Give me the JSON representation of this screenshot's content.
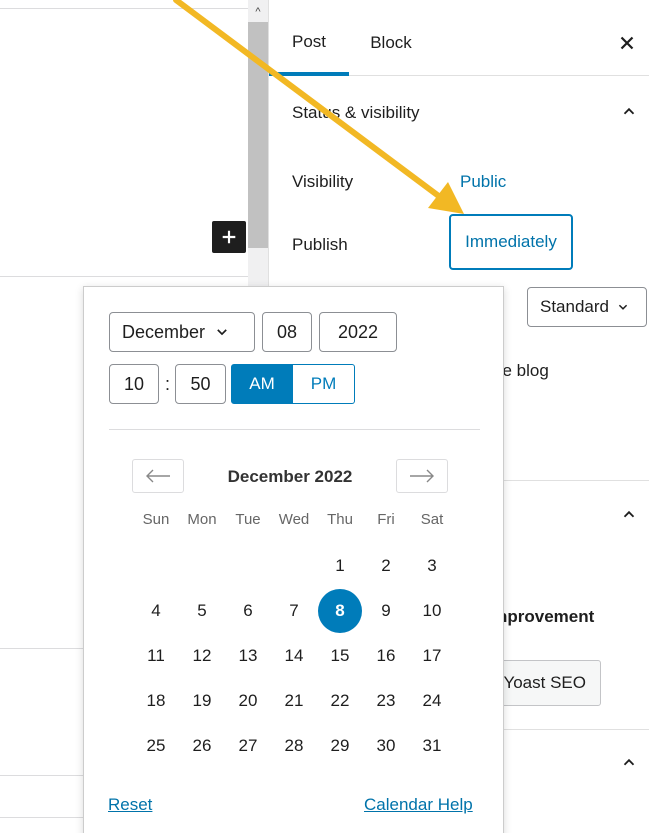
{
  "sidebar": {
    "tabs": [
      {
        "label": "Post"
      },
      {
        "label": "Block"
      }
    ],
    "section_title": "Status & visibility",
    "visibility_label": "Visibility",
    "visibility_value": "Public",
    "publish_label": "Publish",
    "publish_value": "Immediately",
    "format_select": "Standard",
    "partial_text_1": "ne blog",
    "partial_text_2": "nprovement",
    "yoast_button": "Yoast SEO"
  },
  "date_picker": {
    "month": "December",
    "day": "08",
    "year": "2022",
    "hour": "10",
    "minute": "50",
    "am_label": "AM",
    "pm_label": "PM",
    "caption": "December 2022",
    "weekdays": [
      "Sun",
      "Mon",
      "Tue",
      "Wed",
      "Thu",
      "Fri",
      "Sat"
    ],
    "selected_day": "8",
    "weeks": [
      [
        "",
        "",
        "",
        "",
        "1",
        "2",
        "3"
      ],
      [
        "4",
        "5",
        "6",
        "7",
        "8",
        "9",
        "10"
      ],
      [
        "11",
        "12",
        "13",
        "14",
        "15",
        "16",
        "17"
      ],
      [
        "18",
        "19",
        "20",
        "21",
        "22",
        "23",
        "24"
      ],
      [
        "25",
        "26",
        "27",
        "28",
        "29",
        "30",
        "31"
      ]
    ],
    "reset_label": "Reset",
    "help_label": "Calendar Help"
  },
  "colors": {
    "accent": "#007cba",
    "link": "#0073aa",
    "annotation_arrow": "#f2b824"
  },
  "icons": [
    "scroll-up-icon",
    "plus-icon",
    "close-icon",
    "chevron-up-icon",
    "chevron-down-icon",
    "arrow-left-icon",
    "arrow-right-icon"
  ]
}
